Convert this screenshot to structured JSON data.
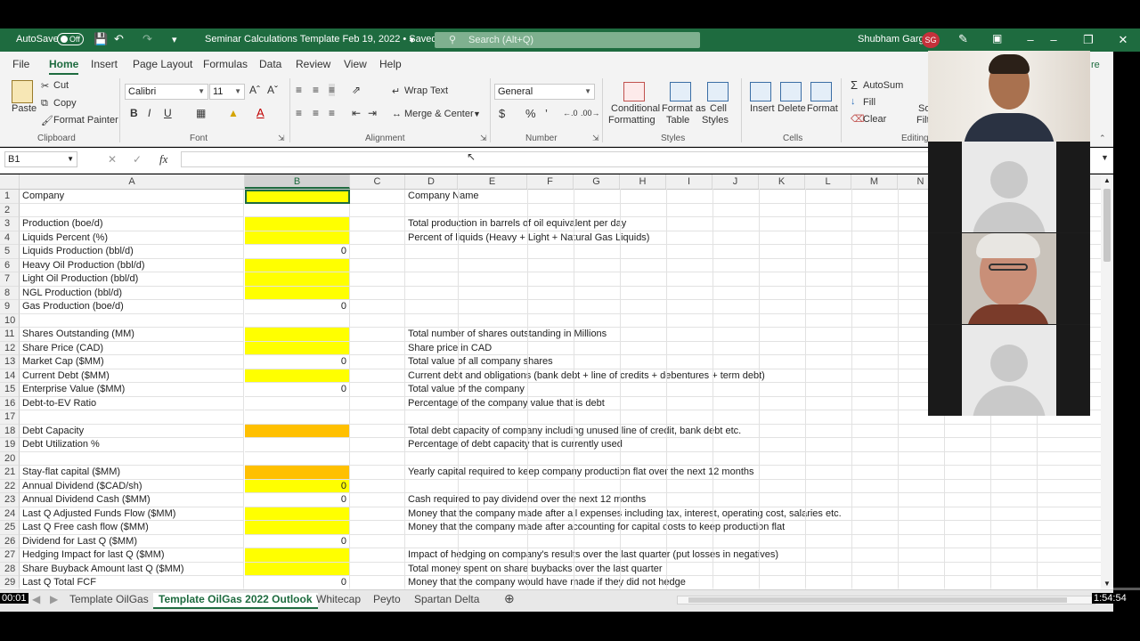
{
  "titlebar": {
    "autosave_label": "AutoSave",
    "autosave_state": "Off",
    "doc_title": "Seminar Calculations Template Feb 19, 2022 • Saved",
    "search_placeholder": "Search (Alt+Q)",
    "user_name": "Shubham Garg",
    "user_initials": "SG"
  },
  "ribbon_tabs": [
    "File",
    "Home",
    "Insert",
    "Page Layout",
    "Formulas",
    "Data",
    "Review",
    "View",
    "Help"
  ],
  "ribbon": {
    "clipboard": {
      "paste": "Paste",
      "cut": "Cut",
      "copy": "Copy",
      "format_painter": "Format Painter",
      "group": "Clipboard"
    },
    "font": {
      "name": "Calibri",
      "size": "11",
      "group": "Font"
    },
    "alignment": {
      "wrap": "Wrap Text",
      "merge": "Merge & Center",
      "group": "Alignment"
    },
    "number": {
      "format": "General",
      "group": "Number"
    },
    "styles": {
      "conditional": "Conditional",
      "conditional2": "Formatting",
      "format_as": "Format as",
      "format_as2": "Table",
      "cell": "Cell",
      "cell2": "Styles",
      "group": "Styles"
    },
    "cells": {
      "insert": "Insert",
      "delete": "Delete",
      "format": "Format",
      "group": "Cells"
    },
    "editing": {
      "autosum": "AutoSum",
      "fill": "Fill",
      "clear": "Clear",
      "group": "Editing",
      "sort1": "So",
      "sort2": "Filt",
      "extra": "re"
    }
  },
  "formula_bar": {
    "namebox": "B1",
    "fx": "fx"
  },
  "columns": [
    "A",
    "B",
    "C",
    "D",
    "E",
    "F",
    "G",
    "H",
    "I",
    "J",
    "K",
    "L",
    "M",
    "N"
  ],
  "rows": [
    {
      "n": "1",
      "a": "Company",
      "b": "",
      "fill": "yellow",
      "d": "Company Name"
    },
    {
      "n": "2",
      "a": "",
      "b": "",
      "fill": "",
      "d": ""
    },
    {
      "n": "3",
      "a": "Production (boe/d)",
      "b": "",
      "fill": "yellow",
      "d": "Total production in barrels of oil equivalent per day"
    },
    {
      "n": "4",
      "a": "Liquids Percent (%)",
      "b": "",
      "fill": "yellow",
      "d": "Percent of liquids (Heavy + Light + Natural Gas Liquids)"
    },
    {
      "n": "5",
      "a": "Liquids Production (bbl/d)",
      "b": "0",
      "fill": "",
      "d": ""
    },
    {
      "n": "6",
      "a": "Heavy Oil Production (bbl/d)",
      "b": "",
      "fill": "yellow",
      "d": ""
    },
    {
      "n": "7",
      "a": "Light Oil Production (bbl/d)",
      "b": "",
      "fill": "yellow",
      "d": ""
    },
    {
      "n": "8",
      "a": "NGL Production (bbl/d)",
      "b": "",
      "fill": "yellow",
      "d": ""
    },
    {
      "n": "9",
      "a": "Gas Production (boe/d)",
      "b": "0",
      "fill": "",
      "d": ""
    },
    {
      "n": "10",
      "a": "",
      "b": "",
      "fill": "",
      "d": ""
    },
    {
      "n": "11",
      "a": "Shares Outstanding (MM)",
      "b": "",
      "fill": "yellow",
      "d": "Total number of shares outstanding in Millions"
    },
    {
      "n": "12",
      "a": "Share Price (CAD)",
      "b": "",
      "fill": "yellow",
      "d": "Share price in CAD"
    },
    {
      "n": "13",
      "a": "Market Cap ($MM)",
      "b": "0",
      "fill": "",
      "d": "Total value of all company shares"
    },
    {
      "n": "14",
      "a": "Current Debt ($MM)",
      "b": "",
      "fill": "yellow",
      "d": "Current debt and obligations (bank debt + line of credits + debentures + term debt)"
    },
    {
      "n": "15",
      "a": "Enterprise Value ($MM)",
      "b": "0",
      "fill": "",
      "d": "Total value of the company"
    },
    {
      "n": "16",
      "a": "Debt-to-EV Ratio",
      "b": "",
      "fill": "",
      "d": "Percentage of the company value that is debt"
    },
    {
      "n": "17",
      "a": "",
      "b": "",
      "fill": "",
      "d": ""
    },
    {
      "n": "18",
      "a": "Debt Capacity",
      "b": "",
      "fill": "orange",
      "d": "Total debt capacity of company including unused line of credit, bank debt etc."
    },
    {
      "n": "19",
      "a": "Debt Utilization %",
      "b": "",
      "fill": "",
      "d": "Percentage of debt capacity that is currently used"
    },
    {
      "n": "20",
      "a": "",
      "b": "",
      "fill": "",
      "d": ""
    },
    {
      "n": "21",
      "a": "Stay-flat capital ($MM)",
      "b": "",
      "fill": "orange",
      "d": "Yearly capital required to keep company production flat over the next 12 months"
    },
    {
      "n": "22",
      "a": "Annual Dividend ($CAD/sh)",
      "b": "0",
      "fill": "yellow",
      "d": ""
    },
    {
      "n": "23",
      "a": "Annual Dividend Cash ($MM)",
      "b": "0",
      "fill": "",
      "d": "Cash required to pay dividend over the next 12 months"
    },
    {
      "n": "24",
      "a": "Last Q Adjusted Funds Flow ($MM)",
      "b": "",
      "fill": "yellow",
      "d": "Money that the company made after all expenses including tax, interest, operating cost, salaries etc."
    },
    {
      "n": "25",
      "a": "Last Q Free cash flow ($MM)",
      "b": "",
      "fill": "yellow",
      "d": "Money that the company made after accounting for capital costs to keep production flat"
    },
    {
      "n": "26",
      "a": "Dividend for Last Q ($MM)",
      "b": "0",
      "fill": "",
      "d": ""
    },
    {
      "n": "27",
      "a": "Hedging Impact for last Q ($MM)",
      "b": "",
      "fill": "yellow",
      "d": "Impact of hedging on company's results over the last quarter (put losses in negatives)"
    },
    {
      "n": "28",
      "a": "Share Buyback Amount last Q ($MM)",
      "b": "",
      "fill": "yellow",
      "d": "Total money spent on share buybacks over the last quarter"
    },
    {
      "n": "29",
      "a": "Last Q Total FCF",
      "b": "0",
      "fill": "",
      "d": "Money that the company would have made if they did not hedge"
    }
  ],
  "sheet_tabs": [
    "Template OilGas",
    "Template OilGas 2022 Outlook",
    "Whitecap",
    "Peyto",
    "Spartan Delta"
  ],
  "video": {
    "elapsed": "00:01",
    "total": "1:54:54",
    "progress": 0.0
  }
}
